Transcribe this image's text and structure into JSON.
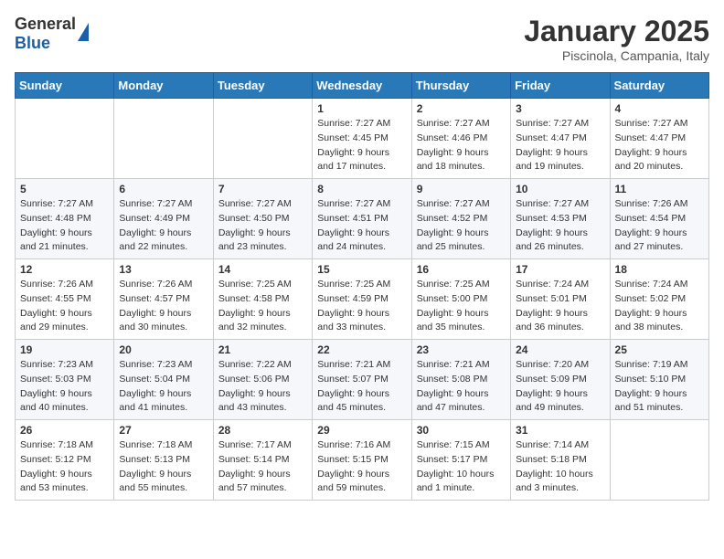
{
  "header": {
    "logo": {
      "general": "General",
      "blue": "Blue"
    },
    "title": "January 2025",
    "subtitle": "Piscinola, Campania, Italy"
  },
  "calendar": {
    "headers": [
      "Sunday",
      "Monday",
      "Tuesday",
      "Wednesday",
      "Thursday",
      "Friday",
      "Saturday"
    ],
    "weeks": [
      [
        {
          "day": "",
          "info": ""
        },
        {
          "day": "",
          "info": ""
        },
        {
          "day": "",
          "info": ""
        },
        {
          "day": "1",
          "info": "Sunrise: 7:27 AM\nSunset: 4:45 PM\nDaylight: 9 hours\nand 17 minutes."
        },
        {
          "day": "2",
          "info": "Sunrise: 7:27 AM\nSunset: 4:46 PM\nDaylight: 9 hours\nand 18 minutes."
        },
        {
          "day": "3",
          "info": "Sunrise: 7:27 AM\nSunset: 4:47 PM\nDaylight: 9 hours\nand 19 minutes."
        },
        {
          "day": "4",
          "info": "Sunrise: 7:27 AM\nSunset: 4:47 PM\nDaylight: 9 hours\nand 20 minutes."
        }
      ],
      [
        {
          "day": "5",
          "info": "Sunrise: 7:27 AM\nSunset: 4:48 PM\nDaylight: 9 hours\nand 21 minutes."
        },
        {
          "day": "6",
          "info": "Sunrise: 7:27 AM\nSunset: 4:49 PM\nDaylight: 9 hours\nand 22 minutes."
        },
        {
          "day": "7",
          "info": "Sunrise: 7:27 AM\nSunset: 4:50 PM\nDaylight: 9 hours\nand 23 minutes."
        },
        {
          "day": "8",
          "info": "Sunrise: 7:27 AM\nSunset: 4:51 PM\nDaylight: 9 hours\nand 24 minutes."
        },
        {
          "day": "9",
          "info": "Sunrise: 7:27 AM\nSunset: 4:52 PM\nDaylight: 9 hours\nand 25 minutes."
        },
        {
          "day": "10",
          "info": "Sunrise: 7:27 AM\nSunset: 4:53 PM\nDaylight: 9 hours\nand 26 minutes."
        },
        {
          "day": "11",
          "info": "Sunrise: 7:26 AM\nSunset: 4:54 PM\nDaylight: 9 hours\nand 27 minutes."
        }
      ],
      [
        {
          "day": "12",
          "info": "Sunrise: 7:26 AM\nSunset: 4:55 PM\nDaylight: 9 hours\nand 29 minutes."
        },
        {
          "day": "13",
          "info": "Sunrise: 7:26 AM\nSunset: 4:57 PM\nDaylight: 9 hours\nand 30 minutes."
        },
        {
          "day": "14",
          "info": "Sunrise: 7:25 AM\nSunset: 4:58 PM\nDaylight: 9 hours\nand 32 minutes."
        },
        {
          "day": "15",
          "info": "Sunrise: 7:25 AM\nSunset: 4:59 PM\nDaylight: 9 hours\nand 33 minutes."
        },
        {
          "day": "16",
          "info": "Sunrise: 7:25 AM\nSunset: 5:00 PM\nDaylight: 9 hours\nand 35 minutes."
        },
        {
          "day": "17",
          "info": "Sunrise: 7:24 AM\nSunset: 5:01 PM\nDaylight: 9 hours\nand 36 minutes."
        },
        {
          "day": "18",
          "info": "Sunrise: 7:24 AM\nSunset: 5:02 PM\nDaylight: 9 hours\nand 38 minutes."
        }
      ],
      [
        {
          "day": "19",
          "info": "Sunrise: 7:23 AM\nSunset: 5:03 PM\nDaylight: 9 hours\nand 40 minutes."
        },
        {
          "day": "20",
          "info": "Sunrise: 7:23 AM\nSunset: 5:04 PM\nDaylight: 9 hours\nand 41 minutes."
        },
        {
          "day": "21",
          "info": "Sunrise: 7:22 AM\nSunset: 5:06 PM\nDaylight: 9 hours\nand 43 minutes."
        },
        {
          "day": "22",
          "info": "Sunrise: 7:21 AM\nSunset: 5:07 PM\nDaylight: 9 hours\nand 45 minutes."
        },
        {
          "day": "23",
          "info": "Sunrise: 7:21 AM\nSunset: 5:08 PM\nDaylight: 9 hours\nand 47 minutes."
        },
        {
          "day": "24",
          "info": "Sunrise: 7:20 AM\nSunset: 5:09 PM\nDaylight: 9 hours\nand 49 minutes."
        },
        {
          "day": "25",
          "info": "Sunrise: 7:19 AM\nSunset: 5:10 PM\nDaylight: 9 hours\nand 51 minutes."
        }
      ],
      [
        {
          "day": "26",
          "info": "Sunrise: 7:18 AM\nSunset: 5:12 PM\nDaylight: 9 hours\nand 53 minutes."
        },
        {
          "day": "27",
          "info": "Sunrise: 7:18 AM\nSunset: 5:13 PM\nDaylight: 9 hours\nand 55 minutes."
        },
        {
          "day": "28",
          "info": "Sunrise: 7:17 AM\nSunset: 5:14 PM\nDaylight: 9 hours\nand 57 minutes."
        },
        {
          "day": "29",
          "info": "Sunrise: 7:16 AM\nSunset: 5:15 PM\nDaylight: 9 hours\nand 59 minutes."
        },
        {
          "day": "30",
          "info": "Sunrise: 7:15 AM\nSunset: 5:17 PM\nDaylight: 10 hours\nand 1 minute."
        },
        {
          "day": "31",
          "info": "Sunrise: 7:14 AM\nSunset: 5:18 PM\nDaylight: 10 hours\nand 3 minutes."
        },
        {
          "day": "",
          "info": ""
        }
      ]
    ]
  }
}
